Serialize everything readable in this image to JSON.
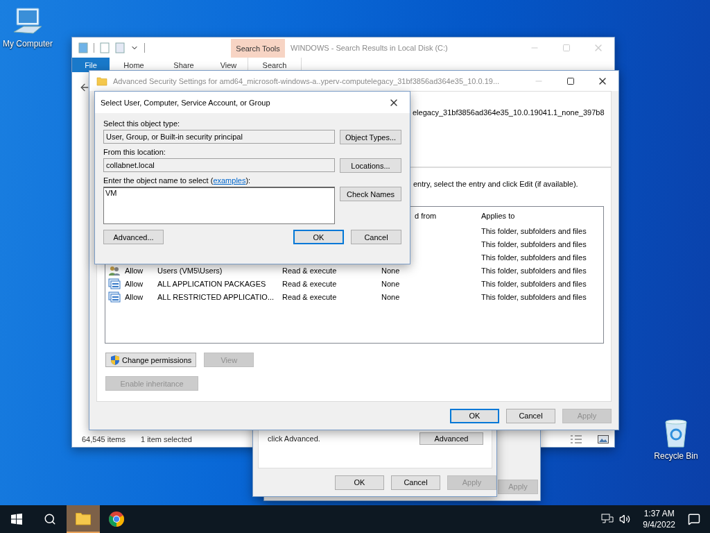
{
  "desktop_icons": [
    {
      "kind": "computer",
      "label": "My Computer"
    },
    {
      "kind": "recycle",
      "label": "Recycle Bin"
    }
  ],
  "explorer": {
    "context_tab": "Search Tools",
    "title": "WINDOWS - Search Results in Local Disk (C:)",
    "ribbon_tabs": [
      {
        "kind": "file",
        "label": "File",
        "selected": false
      },
      {
        "kind": "tab",
        "label": "Home",
        "selected": false
      },
      {
        "kind": "tab",
        "label": "Share",
        "selected": false
      },
      {
        "kind": "tab",
        "label": "View",
        "selected": false
      },
      {
        "kind": "tab",
        "label": "Search",
        "selected": true
      }
    ],
    "status": [
      "64,545 items",
      "1 item selected"
    ]
  },
  "back_dialog": {
    "buttons": [
      {
        "label": "Apply",
        "disabled": true,
        "default": false
      }
    ]
  },
  "properties_dialog": {
    "note": "click Advanced.",
    "advanced_button": "Advanced",
    "buttons": [
      {
        "label": "OK",
        "disabled": false,
        "default": false
      },
      {
        "label": "Cancel",
        "disabled": false,
        "default": false
      },
      {
        "label": "Apply",
        "disabled": true,
        "default": false
      }
    ]
  },
  "advanced_security": {
    "title": "Advanced Security Settings for amd64_microsoft-windows-a..yperv-computelegacy_31bf3856ad364e35_10.0.19...",
    "object_name": "elegacy_31bf3856ad364e35_10.0.19041.1_none_397b8",
    "instructions": "entry, select the entry and click Edit (if available).",
    "columns": [
      "d from",
      "Applies to"
    ],
    "rows": [
      {
        "applies_to": "This folder, subfolders and files"
      },
      {
        "applies_to": "This folder, subfolders and files"
      },
      {
        "applies_to": "This folder, subfolders and files"
      },
      {
        "kind": "users",
        "type": "Allow",
        "principal": "Users (VM5\\Users)",
        "access": "Read & execute",
        "inherited": "None",
        "applies_to": "This folder, subfolders and files"
      },
      {
        "kind": "package",
        "type": "Allow",
        "principal": "ALL APPLICATION PACKAGES",
        "access": "Read & execute",
        "inherited": "None",
        "applies_to": "This folder, subfolders and files"
      },
      {
        "kind": "package",
        "type": "Allow",
        "principal": "ALL RESTRICTED APPLICATIO...",
        "access": "Read & execute",
        "inherited": "None",
        "applies_to": "This folder, subfolders and files"
      }
    ],
    "actions": [
      {
        "kind": "shield",
        "label": "Change permissions",
        "disabled": false
      },
      {
        "kind": "plain",
        "label": "View",
        "disabled": true
      },
      {
        "kind": "plain",
        "label": "Enable inheritance",
        "disabled": true
      }
    ],
    "buttons": [
      {
        "label": "OK",
        "disabled": false,
        "default": true
      },
      {
        "label": "Cancel",
        "disabled": false,
        "default": false
      },
      {
        "label": "Apply",
        "disabled": true,
        "default": false
      }
    ]
  },
  "select_dialog": {
    "title": "Select User, Computer, Service Account, or Group",
    "object_type_label": "Select this object type:",
    "object_type_value": "User, Group, or Built-in security principal",
    "object_types_button": "Object Types...",
    "location_label": "From this location:",
    "location_value": "collabnet.local",
    "locations_button": "Locations...",
    "name_label": {
      "before": "Enter the object name to select (",
      "link": "examples",
      "after": "):"
    },
    "name_value": "VM",
    "check_names_button": "Check Names",
    "advanced_button": "Advanced...",
    "buttons": [
      {
        "label": "OK",
        "disabled": false,
        "default": true
      },
      {
        "label": "Cancel",
        "disabled": false,
        "default": false
      }
    ]
  },
  "taskbar": {
    "apps": [
      {
        "kind": "explorer",
        "selected": true
      },
      {
        "kind": "chrome",
        "selected": false
      }
    ],
    "time": "1:37 AM",
    "date": "9/4/2022"
  }
}
